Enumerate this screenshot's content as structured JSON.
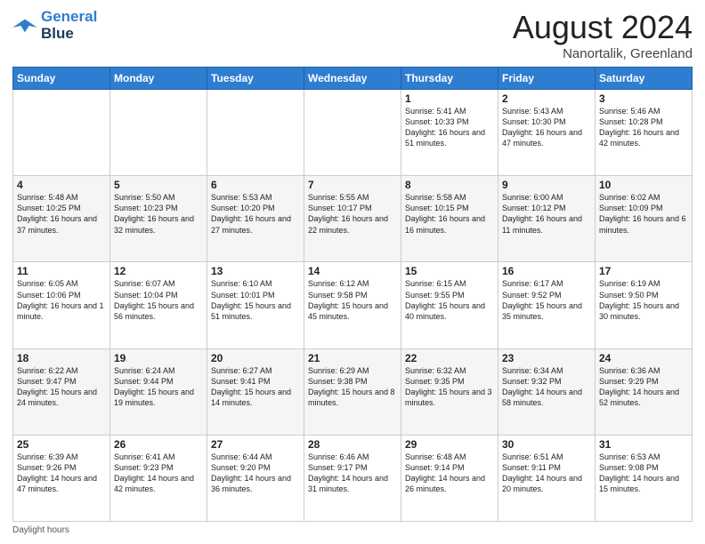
{
  "header": {
    "logo_line1": "General",
    "logo_line2": "Blue",
    "month_title": "August 2024",
    "location": "Nanortalik, Greenland"
  },
  "days_of_week": [
    "Sunday",
    "Monday",
    "Tuesday",
    "Wednesday",
    "Thursday",
    "Friday",
    "Saturday"
  ],
  "footer": {
    "daylight_label": "Daylight hours"
  },
  "weeks": [
    [
      {
        "day": "",
        "text": ""
      },
      {
        "day": "",
        "text": ""
      },
      {
        "day": "",
        "text": ""
      },
      {
        "day": "",
        "text": ""
      },
      {
        "day": "1",
        "text": "Sunrise: 5:41 AM\nSunset: 10:33 PM\nDaylight: 16 hours and 51 minutes."
      },
      {
        "day": "2",
        "text": "Sunrise: 5:43 AM\nSunset: 10:30 PM\nDaylight: 16 hours and 47 minutes."
      },
      {
        "day": "3",
        "text": "Sunrise: 5:46 AM\nSunset: 10:28 PM\nDaylight: 16 hours and 42 minutes."
      }
    ],
    [
      {
        "day": "4",
        "text": "Sunrise: 5:48 AM\nSunset: 10:25 PM\nDaylight: 16 hours and 37 minutes."
      },
      {
        "day": "5",
        "text": "Sunrise: 5:50 AM\nSunset: 10:23 PM\nDaylight: 16 hours and 32 minutes."
      },
      {
        "day": "6",
        "text": "Sunrise: 5:53 AM\nSunset: 10:20 PM\nDaylight: 16 hours and 27 minutes."
      },
      {
        "day": "7",
        "text": "Sunrise: 5:55 AM\nSunset: 10:17 PM\nDaylight: 16 hours and 22 minutes."
      },
      {
        "day": "8",
        "text": "Sunrise: 5:58 AM\nSunset: 10:15 PM\nDaylight: 16 hours and 16 minutes."
      },
      {
        "day": "9",
        "text": "Sunrise: 6:00 AM\nSunset: 10:12 PM\nDaylight: 16 hours and 11 minutes."
      },
      {
        "day": "10",
        "text": "Sunrise: 6:02 AM\nSunset: 10:09 PM\nDaylight: 16 hours and 6 minutes."
      }
    ],
    [
      {
        "day": "11",
        "text": "Sunrise: 6:05 AM\nSunset: 10:06 PM\nDaylight: 16 hours and 1 minute."
      },
      {
        "day": "12",
        "text": "Sunrise: 6:07 AM\nSunset: 10:04 PM\nDaylight: 15 hours and 56 minutes."
      },
      {
        "day": "13",
        "text": "Sunrise: 6:10 AM\nSunset: 10:01 PM\nDaylight: 15 hours and 51 minutes."
      },
      {
        "day": "14",
        "text": "Sunrise: 6:12 AM\nSunset: 9:58 PM\nDaylight: 15 hours and 45 minutes."
      },
      {
        "day": "15",
        "text": "Sunrise: 6:15 AM\nSunset: 9:55 PM\nDaylight: 15 hours and 40 minutes."
      },
      {
        "day": "16",
        "text": "Sunrise: 6:17 AM\nSunset: 9:52 PM\nDaylight: 15 hours and 35 minutes."
      },
      {
        "day": "17",
        "text": "Sunrise: 6:19 AM\nSunset: 9:50 PM\nDaylight: 15 hours and 30 minutes."
      }
    ],
    [
      {
        "day": "18",
        "text": "Sunrise: 6:22 AM\nSunset: 9:47 PM\nDaylight: 15 hours and 24 minutes."
      },
      {
        "day": "19",
        "text": "Sunrise: 6:24 AM\nSunset: 9:44 PM\nDaylight: 15 hours and 19 minutes."
      },
      {
        "day": "20",
        "text": "Sunrise: 6:27 AM\nSunset: 9:41 PM\nDaylight: 15 hours and 14 minutes."
      },
      {
        "day": "21",
        "text": "Sunrise: 6:29 AM\nSunset: 9:38 PM\nDaylight: 15 hours and 8 minutes."
      },
      {
        "day": "22",
        "text": "Sunrise: 6:32 AM\nSunset: 9:35 PM\nDaylight: 15 hours and 3 minutes."
      },
      {
        "day": "23",
        "text": "Sunrise: 6:34 AM\nSunset: 9:32 PM\nDaylight: 14 hours and 58 minutes."
      },
      {
        "day": "24",
        "text": "Sunrise: 6:36 AM\nSunset: 9:29 PM\nDaylight: 14 hours and 52 minutes."
      }
    ],
    [
      {
        "day": "25",
        "text": "Sunrise: 6:39 AM\nSunset: 9:26 PM\nDaylight: 14 hours and 47 minutes."
      },
      {
        "day": "26",
        "text": "Sunrise: 6:41 AM\nSunset: 9:23 PM\nDaylight: 14 hours and 42 minutes."
      },
      {
        "day": "27",
        "text": "Sunrise: 6:44 AM\nSunset: 9:20 PM\nDaylight: 14 hours and 36 minutes."
      },
      {
        "day": "28",
        "text": "Sunrise: 6:46 AM\nSunset: 9:17 PM\nDaylight: 14 hours and 31 minutes."
      },
      {
        "day": "29",
        "text": "Sunrise: 6:48 AM\nSunset: 9:14 PM\nDaylight: 14 hours and 26 minutes."
      },
      {
        "day": "30",
        "text": "Sunrise: 6:51 AM\nSunset: 9:11 PM\nDaylight: 14 hours and 20 minutes."
      },
      {
        "day": "31",
        "text": "Sunrise: 6:53 AM\nSunset: 9:08 PM\nDaylight: 14 hours and 15 minutes."
      }
    ]
  ]
}
